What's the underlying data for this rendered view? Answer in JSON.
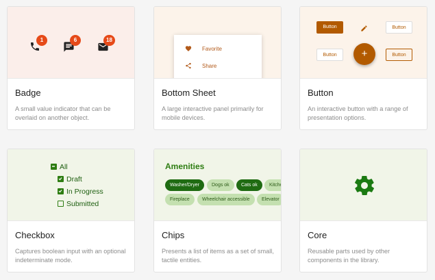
{
  "cards": [
    {
      "title": "Badge",
      "description": "A small value indicator that can be overlaid on another object.",
      "badges": [
        "1",
        "6",
        "18"
      ],
      "icons": [
        "phone-icon",
        "chat-icon",
        "mail-icon"
      ]
    },
    {
      "title": "Bottom Sheet",
      "description": "A large interactive panel primarily for mobile devices.",
      "items": [
        {
          "label": "Favorite",
          "icon": "heart-icon"
        },
        {
          "label": "Share",
          "icon": "share-icon"
        }
      ]
    },
    {
      "title": "Button",
      "description": "An interactive button with a range of presentation options.",
      "buttons": [
        "Button",
        "Button",
        "Button",
        "Button"
      ],
      "fab": "+",
      "icons": [
        "pencil-icon"
      ]
    },
    {
      "title": "Checkbox",
      "description": "Captures boolean input with an optional indeterminate mode.",
      "options": [
        {
          "label": "All",
          "state": "indeterminate"
        },
        {
          "label": "Draft",
          "state": "checked"
        },
        {
          "label": "In Progress",
          "state": "checked"
        },
        {
          "label": "Submitted",
          "state": "unchecked"
        }
      ]
    },
    {
      "title": "Chips",
      "description": "Presents a list of items as a set of small, tactile entities.",
      "heading": "Amenities",
      "row1": [
        {
          "label": "Washer/Dryer",
          "selected": true
        },
        {
          "label": "Dogs ok",
          "selected": false
        },
        {
          "label": "Cats ok",
          "selected": true
        },
        {
          "label": "Kitchen",
          "selected": false
        }
      ],
      "row2": [
        {
          "label": "Fireplace",
          "selected": false
        },
        {
          "label": "Wheelchair accessible",
          "selected": false
        },
        {
          "label": "Elevator",
          "selected": false
        }
      ]
    },
    {
      "title": "Core",
      "description": "Reusable parts used by other components in the library.",
      "icons": [
        "gear-icon"
      ]
    }
  ],
  "colors": {
    "accent_orange": "#b25a00",
    "badge_red": "#e64a19",
    "accent_green": "#2e7d12"
  }
}
